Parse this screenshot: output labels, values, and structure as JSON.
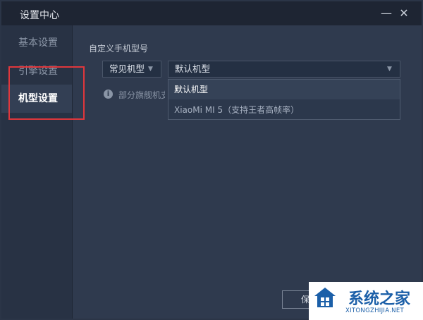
{
  "window": {
    "title": "设置中心"
  },
  "controls": {
    "minimize": "—",
    "close": "✕"
  },
  "sidebar": {
    "items": [
      {
        "label": "基本设置",
        "active": false
      },
      {
        "label": "引擎设置",
        "active": false
      },
      {
        "label": "机型设置",
        "active": true
      }
    ]
  },
  "model_settings": {
    "section_label": "自定义手机型号",
    "category_select": {
      "value": "常见机型"
    },
    "model_select": {
      "value": "默认机型"
    },
    "options": [
      {
        "label": "默认机型"
      },
      {
        "label": "XiaoMi MI 5（支持王者高帧率）"
      }
    ],
    "info_icon": "info-icon",
    "info_text": "部分旗舰机支"
  },
  "footer": {
    "save_label": "保"
  },
  "watermark": {
    "brand": "系统之家",
    "url": "XITONGZHIJIA.NET"
  },
  "colors": {
    "highlight_border": "#e0373c",
    "background": "#2f3a4e",
    "titlebar": "#1e2533"
  }
}
